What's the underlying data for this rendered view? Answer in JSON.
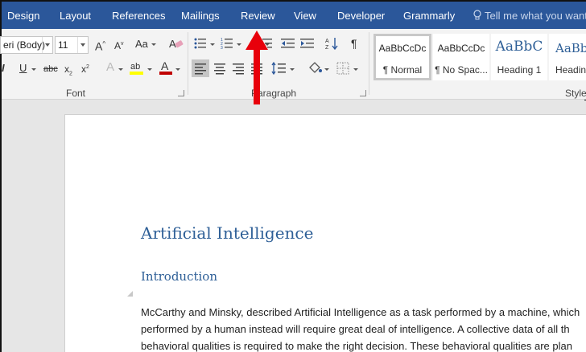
{
  "tabs": [
    {
      "label": "Design"
    },
    {
      "label": "Layout"
    },
    {
      "label": "References"
    },
    {
      "label": "Mailings"
    },
    {
      "label": "Review"
    },
    {
      "label": "View"
    },
    {
      "label": "Developer"
    },
    {
      "label": "Grammarly"
    }
  ],
  "tell_me": {
    "placeholder": "Tell me what you want"
  },
  "font": {
    "name": "eri (Body)",
    "size": "11",
    "group_label": "Font",
    "highlight_color": "#ffff00",
    "font_color": "#c00000"
  },
  "paragraph": {
    "group_label": "Paragraph"
  },
  "styles": {
    "group_label": "Styles",
    "items": [
      {
        "sample": "AaBbCcDc",
        "name": "¶ Normal"
      },
      {
        "sample": "AaBbCcDc",
        "name": "¶ No Spac..."
      },
      {
        "sample": "AaBbC",
        "name": "Heading 1"
      },
      {
        "sample": "AaBbC",
        "name": "Headin"
      }
    ]
  },
  "document": {
    "title": "Artificial Intelligence",
    "subheading": "Introduction",
    "lines": [
      "McCarthy and Minsky, described Artificial Intelligence as a task performed by a machine, which",
      "performed by a human instead will require great deal of intelligence. A collective data of all th",
      "behavioral qualities is required to make the right decision. These behavioral qualities are plan"
    ]
  },
  "annotation": {
    "color": "#e8000b",
    "points_to": "Review"
  }
}
